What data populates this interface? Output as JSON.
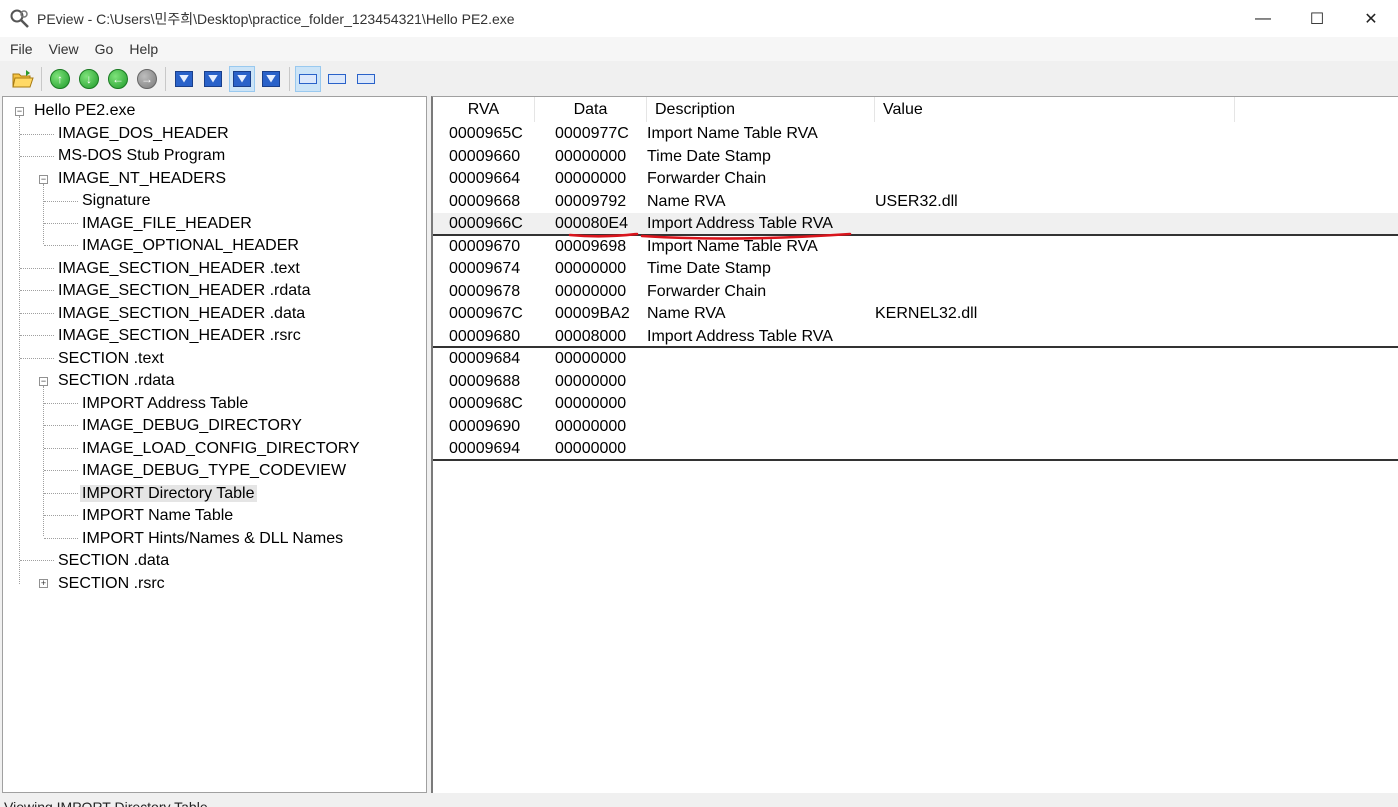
{
  "window": {
    "title": "PEview - C:\\Users\\민주희\\Desktop\\practice_folder_123454321\\Hello PE2.exe",
    "minimize": "—",
    "maximize": "☐",
    "close": "✕"
  },
  "menu": [
    "File",
    "View",
    "Go",
    "Help"
  ],
  "toolbar": {
    "icons": [
      "open-file-icon",
      "up-icon",
      "down-icon",
      "back-icon",
      "forward-icon",
      "save-down-icon",
      "save-mail-icon",
      "download-icon",
      "download-alt-icon",
      "view-bytes-icon",
      "view-words-icon",
      "view-dwords-icon"
    ],
    "arrow_up": "↑",
    "arrow_down": "↓",
    "arrow_back": "←",
    "arrow_forward": "→"
  },
  "tree": {
    "expand": "+",
    "collapse": "−",
    "items": [
      {
        "label": "Hello PE2.exe"
      },
      {
        "label": "IMAGE_DOS_HEADER"
      },
      {
        "label": "MS-DOS Stub Program"
      },
      {
        "label": "IMAGE_NT_HEADERS"
      },
      {
        "label": "Signature"
      },
      {
        "label": "IMAGE_FILE_HEADER"
      },
      {
        "label": "IMAGE_OPTIONAL_HEADER"
      },
      {
        "label": "IMAGE_SECTION_HEADER .text"
      },
      {
        "label": "IMAGE_SECTION_HEADER .rdata"
      },
      {
        "label": "IMAGE_SECTION_HEADER .data"
      },
      {
        "label": "IMAGE_SECTION_HEADER .rsrc"
      },
      {
        "label": "SECTION .text"
      },
      {
        "label": "SECTION .rdata"
      },
      {
        "label": "IMPORT Address Table"
      },
      {
        "label": "IMAGE_DEBUG_DIRECTORY"
      },
      {
        "label": "IMAGE_LOAD_CONFIG_DIRECTORY"
      },
      {
        "label": "IMAGE_DEBUG_TYPE_CODEVIEW"
      },
      {
        "label": "IMPORT Directory Table"
      },
      {
        "label": "IMPORT Name Table"
      },
      {
        "label": "IMPORT Hints/Names & DLL Names"
      },
      {
        "label": "SECTION .data"
      },
      {
        "label": "SECTION .rsrc"
      }
    ]
  },
  "table": {
    "columns": [
      "RVA",
      "Data",
      "Description",
      "Value"
    ],
    "rows": [
      {
        "rva": "0000965C",
        "data": "0000977C",
        "desc": "Import Name Table RVA",
        "value": ""
      },
      {
        "rva": "00009660",
        "data": "00000000",
        "desc": "Time Date Stamp",
        "value": ""
      },
      {
        "rva": "00009664",
        "data": "00000000",
        "desc": "Forwarder Chain",
        "value": ""
      },
      {
        "rva": "00009668",
        "data": "00009792",
        "desc": "Name RVA",
        "value": "USER32.dll"
      },
      {
        "rva": "0000966C",
        "data": "000080E4",
        "desc": "Import Address Table RVA",
        "value": ""
      },
      {
        "rva": "00009670",
        "data": "00009698",
        "desc": "Import Name Table RVA",
        "value": ""
      },
      {
        "rva": "00009674",
        "data": "00000000",
        "desc": "Time Date Stamp",
        "value": ""
      },
      {
        "rva": "00009678",
        "data": "00000000",
        "desc": "Forwarder Chain",
        "value": ""
      },
      {
        "rva": "0000967C",
        "data": "00009BA2",
        "desc": "Name RVA",
        "value": "KERNEL32.dll"
      },
      {
        "rva": "00009680",
        "data": "00008000",
        "desc": "Import Address Table RVA",
        "value": ""
      },
      {
        "rva": "00009684",
        "data": "00000000",
        "desc": "",
        "value": ""
      },
      {
        "rva": "00009688",
        "data": "00000000",
        "desc": "",
        "value": ""
      },
      {
        "rva": "0000968C",
        "data": "00000000",
        "desc": "",
        "value": ""
      },
      {
        "rva": "00009690",
        "data": "00000000",
        "desc": "",
        "value": ""
      },
      {
        "rva": "00009694",
        "data": "00000000",
        "desc": "",
        "value": ""
      }
    ]
  },
  "status": "Viewing IMPORT Directory Table",
  "colors": {
    "annotation": "#d9141c",
    "selection": "#e5e5e5",
    "toolbar_active": "#cce4f7"
  }
}
